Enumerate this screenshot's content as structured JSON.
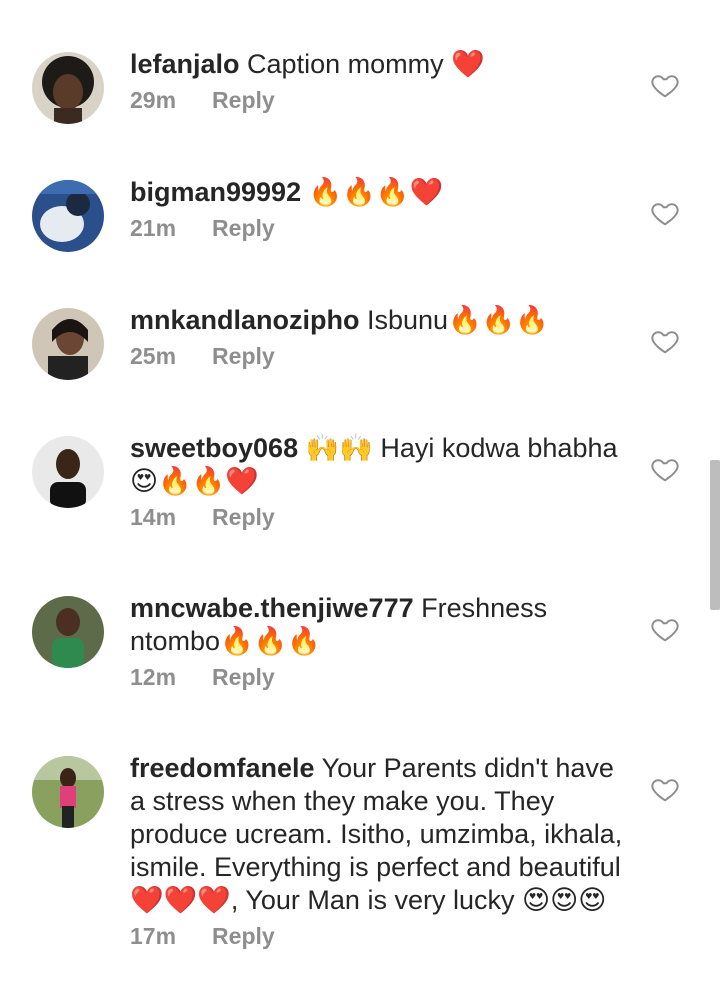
{
  "comments": [
    {
      "username": "lefanjalo",
      "text": " Caption mommy ❤️",
      "time": "29m",
      "reply": "Reply"
    },
    {
      "username": "bigman99992",
      "text": " 🔥🔥🔥❤️",
      "time": "21m",
      "reply": "Reply"
    },
    {
      "username": "mnkandlanozipho",
      "text": " Isbunu🔥🔥🔥",
      "time": "25m",
      "reply": "Reply"
    },
    {
      "username": "sweetboy068",
      "text": " 🙌🙌 Hayi kodwa bhabha 😍🔥🔥❤️",
      "time": "14m",
      "reply": "Reply"
    },
    {
      "username": "mncwabe.thenjiwe777",
      "text": " Freshness ntombo🔥🔥🔥",
      "time": "12m",
      "reply": "Reply"
    },
    {
      "username": "freedomfanele",
      "text": " Your Parents didn't have a stress when they make you. They produce ucream. Isitho, umzimba, ikhala, ismile. Everything is perfect and beautiful ❤️❤️❤️, Your Man is very lucky 😍😍😍",
      "time": "17m",
      "reply": "Reply"
    }
  ],
  "colors": {
    "text": "#262626",
    "meta": "#8e8e8e",
    "icon": "#8e8e8e"
  },
  "icons": {
    "like": "heart-outline-icon"
  }
}
